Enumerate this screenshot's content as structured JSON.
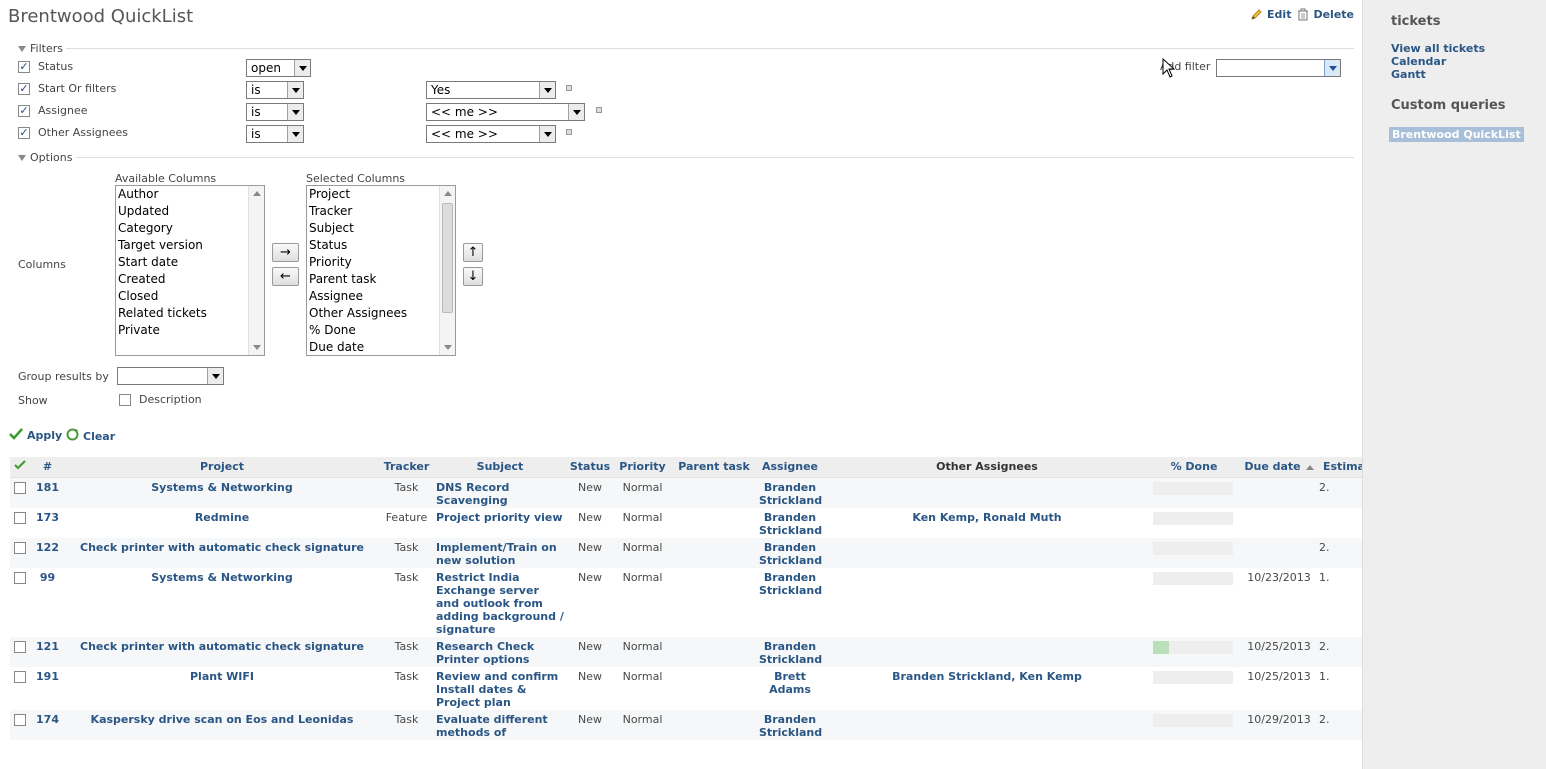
{
  "page": {
    "title": "Brentwood QuickList",
    "edit_label": "Edit",
    "delete_label": "Delete"
  },
  "filters": {
    "legend": "Filters",
    "add_filter_label": "Add filter",
    "add_filter_value": "",
    "rows": [
      {
        "label": "Status",
        "checked": true,
        "operator": "open",
        "value": ""
      },
      {
        "label": "Start Or filters",
        "checked": true,
        "operator": "is",
        "value": "Yes"
      },
      {
        "label": "Assignee",
        "checked": true,
        "operator": "is",
        "value": "<< me >>"
      },
      {
        "label": "Other Assignees",
        "checked": true,
        "operator": "is",
        "value": "<< me >>"
      }
    ]
  },
  "options": {
    "legend": "Options",
    "columns_label": "Columns",
    "available_label": "Available Columns",
    "selected_label": "Selected Columns",
    "available_columns": [
      "Author",
      "Updated",
      "Category",
      "Target version",
      "Start date",
      "Created",
      "Closed",
      "Related tickets",
      "Private"
    ],
    "selected_columns": [
      "Project",
      "Tracker",
      "Subject",
      "Status",
      "Priority",
      "Parent task",
      "Assignee",
      "Other Assignees",
      "% Done",
      "Due date"
    ],
    "move_right": "→",
    "move_left": "←",
    "move_up": "↑",
    "move_down": "↓",
    "group_by_label": "Group results by",
    "group_by_value": "",
    "show_label": "Show",
    "description_label": "Description"
  },
  "actions": {
    "apply": "Apply",
    "clear": "Clear"
  },
  "table": {
    "headers": {
      "id": "#",
      "project": "Project",
      "tracker": "Tracker",
      "subject": "Subject",
      "status": "Status",
      "priority": "Priority",
      "parent": "Parent task",
      "assignee": "Assignee",
      "other": "Other Assignees",
      "done": "% Done",
      "due": "Due date",
      "estimated": "Estima"
    },
    "rows": [
      {
        "id": "181",
        "project": "Systems & Networking",
        "tracker": "Task",
        "subject": "DNS Record Scavenging",
        "status": "New",
        "priority": "Normal",
        "parent": "",
        "assignee": "Branden Strickland",
        "other": "",
        "done": 0,
        "due": "",
        "est": "2."
      },
      {
        "id": "173",
        "project": "Redmine",
        "tracker": "Feature",
        "subject": "Project priority view",
        "status": "New",
        "priority": "Normal",
        "parent": "",
        "assignee": "Branden Strickland",
        "other": "Ken Kemp, Ronald Muth",
        "done": 0,
        "due": "",
        "est": ""
      },
      {
        "id": "122",
        "project": "Check printer with automatic check signature",
        "tracker": "Task",
        "subject": "Implement/Train on new solution",
        "status": "New",
        "priority": "Normal",
        "parent": "",
        "assignee": "Branden Strickland",
        "other": "",
        "done": 0,
        "due": "",
        "est": "2."
      },
      {
        "id": "99",
        "project": "Systems & Networking",
        "tracker": "Task",
        "subject": "Restrict India Exchange server and outlook from adding background / signature",
        "status": "New",
        "priority": "Normal",
        "parent": "",
        "assignee": "Branden Strickland",
        "other": "",
        "done": 0,
        "due": "10/23/2013",
        "est": "1."
      },
      {
        "id": "121",
        "project": "Check printer with automatic check signature",
        "tracker": "Task",
        "subject": "Research Check Printer options",
        "status": "New",
        "priority": "Normal",
        "parent": "",
        "assignee": "Branden Strickland",
        "other": "",
        "done": 20,
        "due": "10/25/2013",
        "est": "2."
      },
      {
        "id": "191",
        "project": "Plant WIFI",
        "tracker": "Task",
        "subject": "Review and confirm Install dates & Project plan",
        "status": "New",
        "priority": "Normal",
        "parent": "",
        "assignee": "Brett Adams",
        "other": "Branden Strickland, Ken Kemp",
        "done": 0,
        "due": "10/25/2013",
        "est": "1."
      },
      {
        "id": "174",
        "project": "Kaspersky drive scan on Eos and Leonidas",
        "tracker": "Task",
        "subject": "Evaluate different methods of",
        "status": "New",
        "priority": "Normal",
        "parent": "",
        "assignee": "Branden Strickland",
        "other": "",
        "done": 0,
        "due": "10/29/2013",
        "est": "2."
      }
    ]
  },
  "sidebar": {
    "title": "tickets",
    "links": [
      "View all tickets",
      "Calendar",
      "Gantt"
    ],
    "custom_title": "Custom queries",
    "selected_query": "Brentwood QuickList"
  },
  "colors": {
    "link": "#2A5685",
    "sidebar_bg": "#EEEEEE",
    "progress_fill": "#BAE0BA",
    "selected_query_bg": "#A8BFD9"
  }
}
